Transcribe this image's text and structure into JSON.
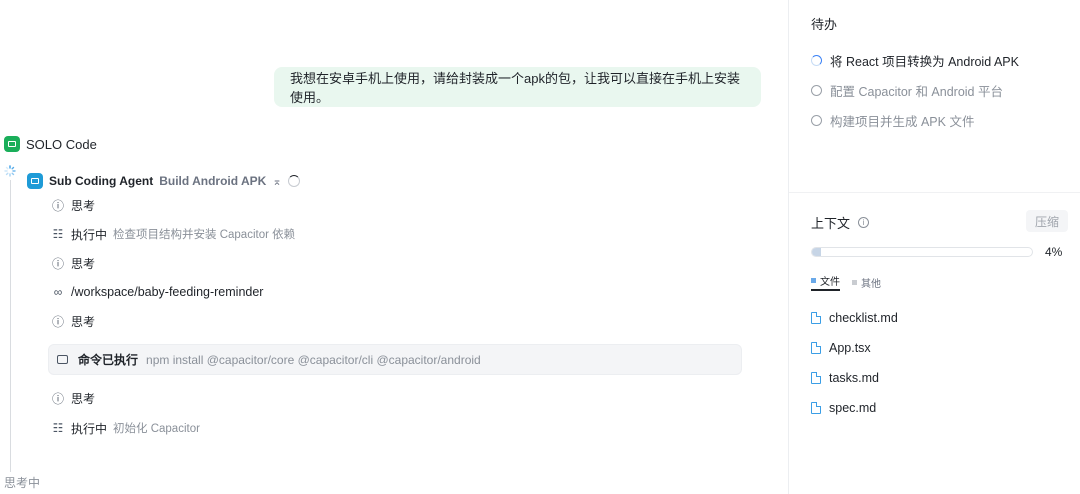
{
  "chat": {
    "user_message": "我想在安卓手机上使用，请给封装成一个apk的包，让我可以直接在手机上安装使用。",
    "assistant_name": "SOLO Code",
    "sub_agent": {
      "name": "Sub Coding Agent",
      "task": "Build Android APK"
    },
    "steps": [
      {
        "icon": "thinking-icon",
        "label": "思考",
        "detail": ""
      },
      {
        "icon": "tasklist-icon",
        "label": "执行中",
        "detail": "检查项目结构并安装 Capacitor 依赖"
      },
      {
        "icon": "thinking-icon",
        "label": "思考",
        "detail": ""
      },
      {
        "icon": "glasses-icon",
        "label": "/workspace/baby-feeding-reminder",
        "detail": ""
      },
      {
        "icon": "thinking-icon",
        "label": "思考",
        "detail": ""
      },
      {
        "icon": "thinking-icon",
        "label": "思考",
        "detail": ""
      },
      {
        "icon": "tasklist-icon",
        "label": "执行中",
        "detail": "初始化 Capacitor"
      }
    ],
    "command": {
      "label": "命令已执行",
      "text": "npm install @capacitor/core @capacitor/cli @capacitor/android"
    },
    "footer_status": "思考中"
  },
  "sidebar": {
    "todo_title": "待办",
    "todos": [
      {
        "label": "将 React 项目转换为 Android APK",
        "state": "in-progress"
      },
      {
        "label": "配置 Capacitor 和 Android 平台",
        "state": "pending"
      },
      {
        "label": "构建项目并生成 APK 文件",
        "state": "pending"
      }
    ],
    "context_title": "上下文",
    "compress_label": "压缩",
    "usage_percent": 4,
    "usage_text": "4%",
    "legend": {
      "files": "文件",
      "other": "其他"
    },
    "files": [
      "checklist.md",
      "App.tsx",
      "tasks.md",
      "spec.md"
    ]
  },
  "colors": {
    "bubble_bg": "#e9f7ef",
    "solo_green": "#1aae5a",
    "agent_blue": "#1e9bd7",
    "file_icon_blue": "#3b9ee6",
    "legend_files": "#6aa9e9",
    "legend_other": "#c9ccd1"
  }
}
